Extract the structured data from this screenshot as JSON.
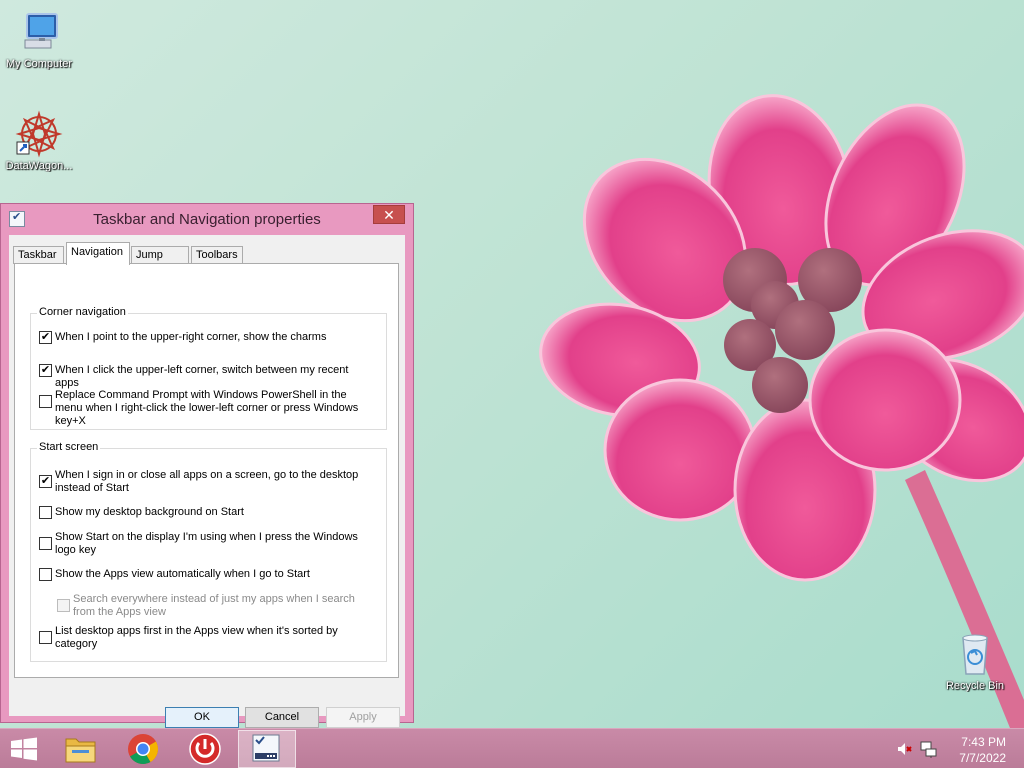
{
  "desktop": {
    "icons": [
      {
        "label": "My Computer",
        "icon": "computer-icon"
      },
      {
        "label": "DataWagon...",
        "icon": "datawagon-icon"
      },
      {
        "label": "Recycle Bin",
        "icon": "recycle-bin-icon"
      }
    ]
  },
  "dialog": {
    "title": "Taskbar and Navigation properties",
    "close_glyph": "✕",
    "tabs": [
      {
        "label": "Taskbar",
        "active": false
      },
      {
        "label": "Navigation",
        "active": true
      },
      {
        "label": "Jump Lists",
        "active": false
      },
      {
        "label": "Toolbars",
        "active": false
      }
    ],
    "corner_navigation": {
      "legend": "Corner navigation",
      "options": [
        {
          "label": "When I point to the upper-right corner, show the charms",
          "checked": true
        },
        {
          "label": "When I click the upper-left corner, switch between my recent apps",
          "checked": true
        },
        {
          "label": "Replace Command Prompt with Windows PowerShell in the menu when I right-click the lower-left corner or press Windows key+X",
          "checked": false
        }
      ]
    },
    "start_screen": {
      "legend": "Start screen",
      "options": [
        {
          "label": "When I sign in or close all apps on a screen, go to the desktop instead of Start",
          "checked": true,
          "disabled": false
        },
        {
          "label": "Show my desktop background on Start",
          "checked": false,
          "disabled": false
        },
        {
          "label": "Show Start on the display I'm using when I press the Windows logo key",
          "checked": false,
          "disabled": false
        },
        {
          "label": "Show the Apps view automatically when I go to Start",
          "checked": false,
          "disabled": false
        },
        {
          "label": "Search everywhere instead of just my apps when I search from the Apps view",
          "checked": false,
          "disabled": true
        },
        {
          "label": "List desktop apps first in the Apps view when it's sorted by category",
          "checked": false,
          "disabled": false
        }
      ]
    },
    "buttons": {
      "ok": "OK",
      "cancel": "Cancel",
      "apply": "Apply"
    }
  },
  "taskbar": {
    "items": [
      {
        "name": "start-button",
        "icon": "windows-logo-icon"
      },
      {
        "name": "file-explorer",
        "icon": "folder-icon"
      },
      {
        "name": "chrome",
        "icon": "chrome-icon"
      },
      {
        "name": "power-app",
        "icon": "power-icon"
      },
      {
        "name": "taskbar-properties",
        "icon": "properties-icon",
        "active": true
      }
    ],
    "clock": {
      "time": "7:43 PM",
      "date": "7/7/2022"
    }
  },
  "colors": {
    "accent": "#e899c0",
    "taskbar": "#c98aa7",
    "flower": "#e8488c"
  }
}
